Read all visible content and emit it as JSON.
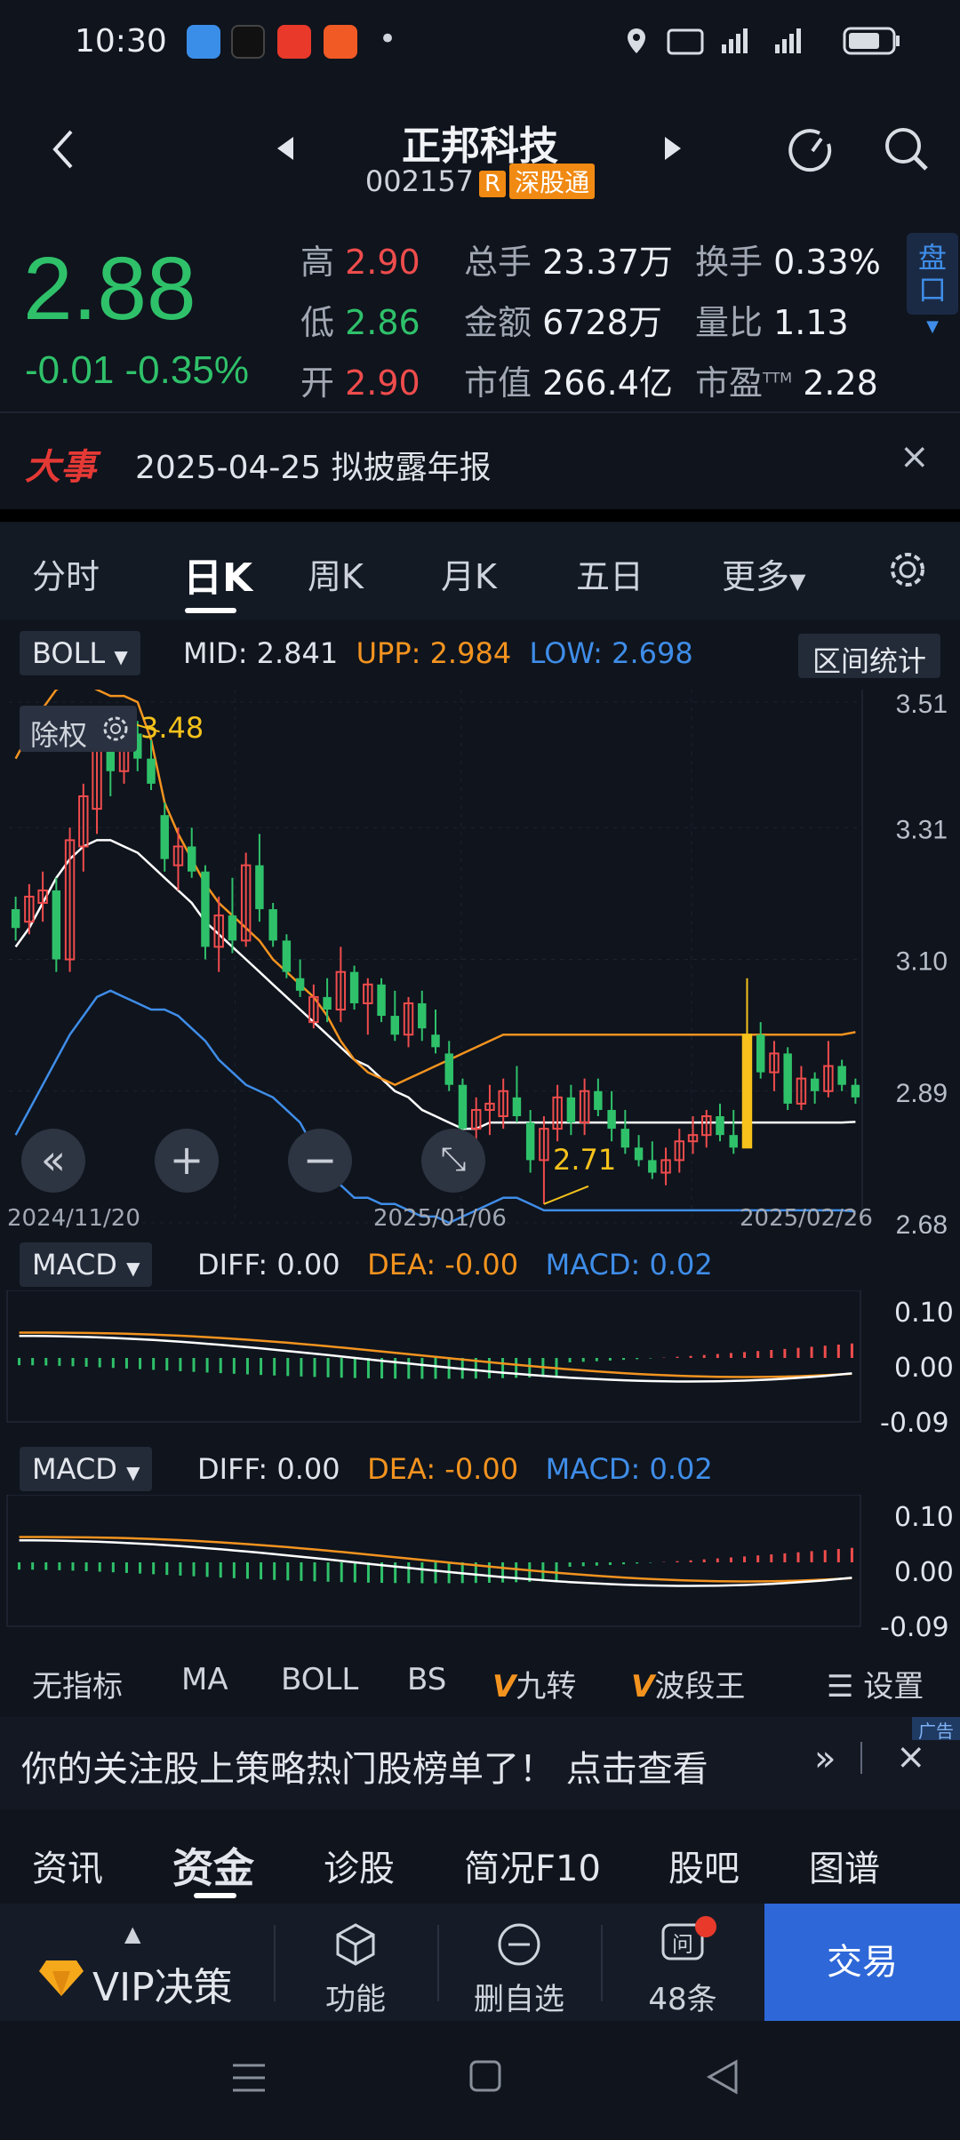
{
  "status_bar": {
    "time": "10:30",
    "dot": "•"
  },
  "header": {
    "title": "正邦科技",
    "code": "002157",
    "tag_r": "R",
    "tag_connect": "深股通"
  },
  "quote": {
    "price": "2.88",
    "change": "-0.01",
    "change_pct": "-0.35%",
    "rows": [
      {
        "l1": "高",
        "v1": "2.90",
        "c1": "red",
        "l2": "总手",
        "v2": "23.37万",
        "l3": "换手",
        "v3": "0.33%"
      },
      {
        "l1": "低",
        "v1": "2.86",
        "c1": "green",
        "l2": "金额",
        "v2": "6728万",
        "l3": "量比",
        "v3": "1.13"
      },
      {
        "l1": "开",
        "v1": "2.90",
        "c1": "red",
        "l2": "市值",
        "v2": "266.4亿",
        "l3": "市盈",
        "v3": "2.28"
      }
    ],
    "pe_sup": "TTM",
    "pankou": "盘口"
  },
  "event": {
    "badge": "大事",
    "text": "2025-04-25 拟披露年报",
    "close": "×"
  },
  "period_tabs": [
    "分时",
    "日K",
    "周K",
    "月K",
    "五日",
    "更多"
  ],
  "main_chart": {
    "indicator": "BOLL",
    "mid_label": "MID:",
    "mid": "2.841",
    "upp_label": "UPP:",
    "upp": "2.984",
    "low_label": "LOW:",
    "low": "2.698",
    "range_stats": "区间统计",
    "chip": "除权",
    "high_mark": "3.48",
    "low_mark": "2.71",
    "dates": [
      "2024/11/20",
      "2025/01/06",
      "2025/02/26"
    ]
  },
  "sub_charts": [
    {
      "indicator": "MACD",
      "diff_label": "DIFF:",
      "diff": "0.00",
      "dea_label": "DEA:",
      "dea": "-0.00",
      "macd_label": "MACD:",
      "macd": "0.02",
      "ticks": [
        "0.10",
        "0.00",
        "-0.09"
      ]
    },
    {
      "indicator": "MACD",
      "diff_label": "DIFF:",
      "diff": "0.00",
      "dea_label": "DEA:",
      "dea": "-0.00",
      "macd_label": "MACD:",
      "macd": "0.02",
      "ticks": [
        "0.10",
        "0.00",
        "-0.09"
      ]
    }
  ],
  "indicator_bar": [
    "无指标",
    "MA",
    "BOLL",
    "BS",
    "九转",
    "波段王",
    "设置"
  ],
  "ad": {
    "text": "你的关注股上策略热门股榜单了！ 点击查看",
    "tag": "广告"
  },
  "bottom_tabs": [
    "资讯",
    "资金",
    "诊股",
    "简况F10",
    "股吧",
    "图谱"
  ],
  "bottom_bar": {
    "vip": "VIP决策",
    "func": "功能",
    "remove": "删自选",
    "msgs": "48条",
    "trade": "交易"
  },
  "colors": {
    "up": "#ef4c4c",
    "down": "#2fc16a",
    "mid_line": "#ffffff",
    "upper_band": "#f3931f",
    "lower_band": "#3f8de8",
    "accent": "#2e67d8"
  },
  "chart_data": {
    "type": "candlestick",
    "title": "",
    "x_labels": [
      "2024/11/20",
      "2025/01/06",
      "2025/02/26"
    ],
    "y_ticks": [
      3.51,
      3.31,
      3.1,
      2.89,
      2.68
    ],
    "ylim": [
      2.68,
      3.53
    ],
    "ohlc": [
      [
        3.18,
        3.2,
        3.13,
        3.15
      ],
      [
        3.16,
        3.22,
        3.14,
        3.2
      ],
      [
        3.19,
        3.24,
        3.16,
        3.21
      ],
      [
        3.21,
        3.23,
        3.08,
        3.1
      ],
      [
        3.1,
        3.31,
        3.08,
        3.29
      ],
      [
        3.28,
        3.38,
        3.24,
        3.36
      ],
      [
        3.34,
        3.46,
        3.3,
        3.44
      ],
      [
        3.44,
        3.48,
        3.36,
        3.4
      ],
      [
        3.4,
        3.48,
        3.38,
        3.47
      ],
      [
        3.46,
        3.48,
        3.4,
        3.42
      ],
      [
        3.42,
        3.45,
        3.37,
        3.38
      ],
      [
        3.33,
        3.35,
        3.24,
        3.26
      ],
      [
        3.25,
        3.31,
        3.21,
        3.28
      ],
      [
        3.28,
        3.31,
        3.23,
        3.24
      ],
      [
        3.24,
        3.25,
        3.1,
        3.12
      ],
      [
        3.12,
        3.2,
        3.08,
        3.17
      ],
      [
        3.17,
        3.23,
        3.11,
        3.13
      ],
      [
        3.13,
        3.27,
        3.12,
        3.25
      ],
      [
        3.25,
        3.3,
        3.16,
        3.18
      ],
      [
        3.18,
        3.19,
        3.12,
        3.13
      ],
      [
        3.13,
        3.14,
        3.07,
        3.08
      ],
      [
        3.07,
        3.1,
        3.04,
        3.05
      ],
      [
        3.0,
        3.06,
        2.99,
        3.04
      ],
      [
        3.04,
        3.07,
        3.0,
        3.02
      ],
      [
        3.02,
        3.12,
        3.0,
        3.08
      ],
      [
        3.08,
        3.09,
        3.02,
        3.03
      ],
      [
        3.03,
        3.07,
        2.98,
        3.06
      ],
      [
        3.06,
        3.07,
        3.0,
        3.01
      ],
      [
        3.01,
        3.05,
        2.97,
        2.98
      ],
      [
        2.98,
        3.04,
        2.96,
        3.03
      ],
      [
        3.03,
        3.05,
        2.97,
        2.99
      ],
      [
        2.98,
        3.02,
        2.95,
        2.96
      ],
      [
        2.95,
        2.97,
        2.89,
        2.9
      ],
      [
        2.9,
        2.91,
        2.82,
        2.83
      ],
      [
        2.83,
        2.88,
        2.8,
        2.86
      ],
      [
        2.86,
        2.9,
        2.82,
        2.87
      ],
      [
        2.85,
        2.91,
        2.83,
        2.89
      ],
      [
        2.88,
        2.93,
        2.84,
        2.85
      ],
      [
        2.84,
        2.86,
        2.76,
        2.78
      ],
      [
        2.78,
        2.85,
        2.71,
        2.83
      ],
      [
        2.83,
        2.9,
        2.81,
        2.88
      ],
      [
        2.88,
        2.9,
        2.82,
        2.84
      ],
      [
        2.84,
        2.91,
        2.82,
        2.89
      ],
      [
        2.89,
        2.91,
        2.85,
        2.86
      ],
      [
        2.86,
        2.89,
        2.81,
        2.83
      ],
      [
        2.83,
        2.86,
        2.79,
        2.8
      ],
      [
        2.8,
        2.82,
        2.77,
        2.78
      ],
      [
        2.78,
        2.81,
        2.75,
        2.76
      ],
      [
        2.76,
        2.8,
        2.74,
        2.78
      ],
      [
        2.78,
        2.83,
        2.76,
        2.81
      ],
      [
        2.81,
        2.85,
        2.79,
        2.82
      ],
      [
        2.82,
        2.86,
        2.8,
        2.85
      ],
      [
        2.85,
        2.87,
        2.81,
        2.82
      ],
      [
        2.82,
        2.86,
        2.79,
        2.8
      ],
      [
        2.8,
        3.07,
        2.8,
        2.98
      ],
      [
        2.98,
        3.0,
        2.91,
        2.92
      ],
      [
        2.92,
        2.97,
        2.89,
        2.95
      ],
      [
        2.95,
        2.96,
        2.86,
        2.87
      ],
      [
        2.87,
        2.93,
        2.86,
        2.91
      ],
      [
        2.91,
        2.92,
        2.87,
        2.89
      ],
      [
        2.89,
        2.97,
        2.88,
        2.93
      ],
      [
        2.93,
        2.94,
        2.89,
        2.9
      ],
      [
        2.9,
        2.91,
        2.87,
        2.88
      ]
    ],
    "series": [
      {
        "name": "MID",
        "values": [
          3.12,
          3.15,
          3.19,
          3.23,
          3.26,
          3.28,
          3.29,
          3.29,
          3.28,
          3.27,
          3.25,
          3.23,
          3.21,
          3.19,
          3.16,
          3.14,
          3.12,
          3.1,
          3.08,
          3.06,
          3.04,
          3.02,
          3.0,
          2.98,
          2.96,
          2.94,
          2.93,
          2.91,
          2.89,
          2.88,
          2.86,
          2.85,
          2.84,
          2.83,
          2.83,
          2.84,
          2.84,
          2.84,
          2.84,
          2.84,
          2.84,
          2.84,
          2.84,
          2.84,
          2.84,
          2.84,
          2.84,
          2.84,
          2.84,
          2.84,
          2.84,
          2.84,
          2.84,
          2.84,
          2.84,
          2.84,
          2.84,
          2.84,
          2.84,
          2.84,
          2.84,
          2.84,
          2.841
        ]
      },
      {
        "name": "UPP",
        "values": [
          3.42,
          3.46,
          3.5,
          3.53,
          3.54,
          3.54,
          3.53,
          3.52,
          3.52,
          3.51,
          3.45,
          3.35,
          3.3,
          3.26,
          3.22,
          3.19,
          3.17,
          3.15,
          3.13,
          3.1,
          3.08,
          3.06,
          3.04,
          3.01,
          2.97,
          2.94,
          2.92,
          2.91,
          2.9,
          2.91,
          2.92,
          2.93,
          2.94,
          2.95,
          2.96,
          2.97,
          2.98,
          2.98,
          2.98,
          2.98,
          2.98,
          2.98,
          2.98,
          2.98,
          2.98,
          2.98,
          2.98,
          2.98,
          2.98,
          2.98,
          2.98,
          2.98,
          2.98,
          2.98,
          2.98,
          2.98,
          2.98,
          2.98,
          2.98,
          2.98,
          2.98,
          2.98,
          2.984
        ]
      },
      {
        "name": "LOW",
        "values": [
          2.82,
          2.86,
          2.9,
          2.94,
          2.98,
          3.01,
          3.04,
          3.05,
          3.04,
          3.03,
          3.02,
          3.02,
          3.01,
          2.99,
          2.97,
          2.94,
          2.92,
          2.9,
          2.89,
          2.88,
          2.86,
          2.84,
          2.8,
          2.77,
          2.74,
          2.72,
          2.72,
          2.71,
          2.71,
          2.7,
          2.69,
          2.69,
          2.68,
          2.69,
          2.7,
          2.71,
          2.72,
          2.72,
          2.71,
          2.7,
          2.7,
          2.7,
          2.7,
          2.7,
          2.7,
          2.7,
          2.7,
          2.7,
          2.7,
          2.7,
          2.7,
          2.7,
          2.7,
          2.7,
          2.7,
          2.7,
          2.7,
          2.7,
          2.7,
          2.7,
          2.7,
          2.7,
          2.698
        ]
      }
    ]
  }
}
